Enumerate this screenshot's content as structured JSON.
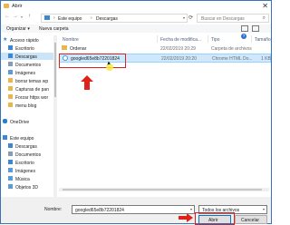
{
  "window": {
    "title": "Abrir",
    "close_glyph": "✕"
  },
  "address": {
    "back_glyph": "←",
    "forward_glyph": "→",
    "up_glyph": "↑",
    "crumbs": [
      "Este equipo",
      "Descargas"
    ],
    "separator": "›",
    "refresh_glyph": "⟳",
    "search_placeholder": "Buscar en Descargas",
    "search_icon": "search-icon"
  },
  "toolbar": {
    "organize_label": "Organizar ▾",
    "new_folder_label": "Nueva carpeta",
    "help_label": "?"
  },
  "nav": {
    "quick_access": {
      "label": "Acceso rápido",
      "items": [
        {
          "label": "Escritorio",
          "color": "#3d86d4"
        },
        {
          "label": "Descargas",
          "color": "#3d86d4"
        },
        {
          "label": "Documentos",
          "color": "#8a9bb0"
        },
        {
          "label": "Imágenes",
          "color": "#5a9bd8"
        },
        {
          "label": "borrar temas wp",
          "color": "#e8b64a"
        },
        {
          "label": "Capturas de pan",
          "color": "#e8b64a"
        },
        {
          "label": "Forzar https wor",
          "color": "#e8b64a"
        },
        {
          "label": "menu blog",
          "color": "#e8b64a"
        }
      ]
    },
    "onedrive": {
      "label": "OneDrive"
    },
    "this_pc": {
      "label": "Este equipo",
      "items": [
        {
          "label": "Descargas",
          "color": "#3d86d4"
        },
        {
          "label": "Documentos",
          "color": "#8a9bb0"
        },
        {
          "label": "Escritorio",
          "color": "#3d86d4"
        },
        {
          "label": "Imágenes",
          "color": "#5a9bd8"
        },
        {
          "label": "Música",
          "color": "#5a9bd8"
        },
        {
          "label": "Objetos 3D",
          "color": "#5a9bd8"
        }
      ]
    }
  },
  "columns": [
    "Nombre",
    "Fecha de modifica...",
    "Tipo",
    "Tamaño"
  ],
  "files": [
    {
      "name": "Ordenar",
      "date": "22/02/2019 20:29",
      "type": "Carpeta de archivos",
      "size": ""
    },
    {
      "name": "googled65e8b72201824",
      "date": "22/02/2019 20:20",
      "type": "Chrome HTML Do...",
      "size": "1 KB"
    }
  ],
  "bottom": {
    "filename_label": "Nombre:",
    "filename_value": "googled65e8b72201824",
    "filetype_value": "Todos los archivos",
    "dropdown_glyph": "▾",
    "open_label": "Abrir",
    "cancel_label": "Cancelar"
  },
  "colors": {
    "highlight_box": "#e0201b",
    "selection": "#cde8ff",
    "accent": "#0078d7"
  }
}
